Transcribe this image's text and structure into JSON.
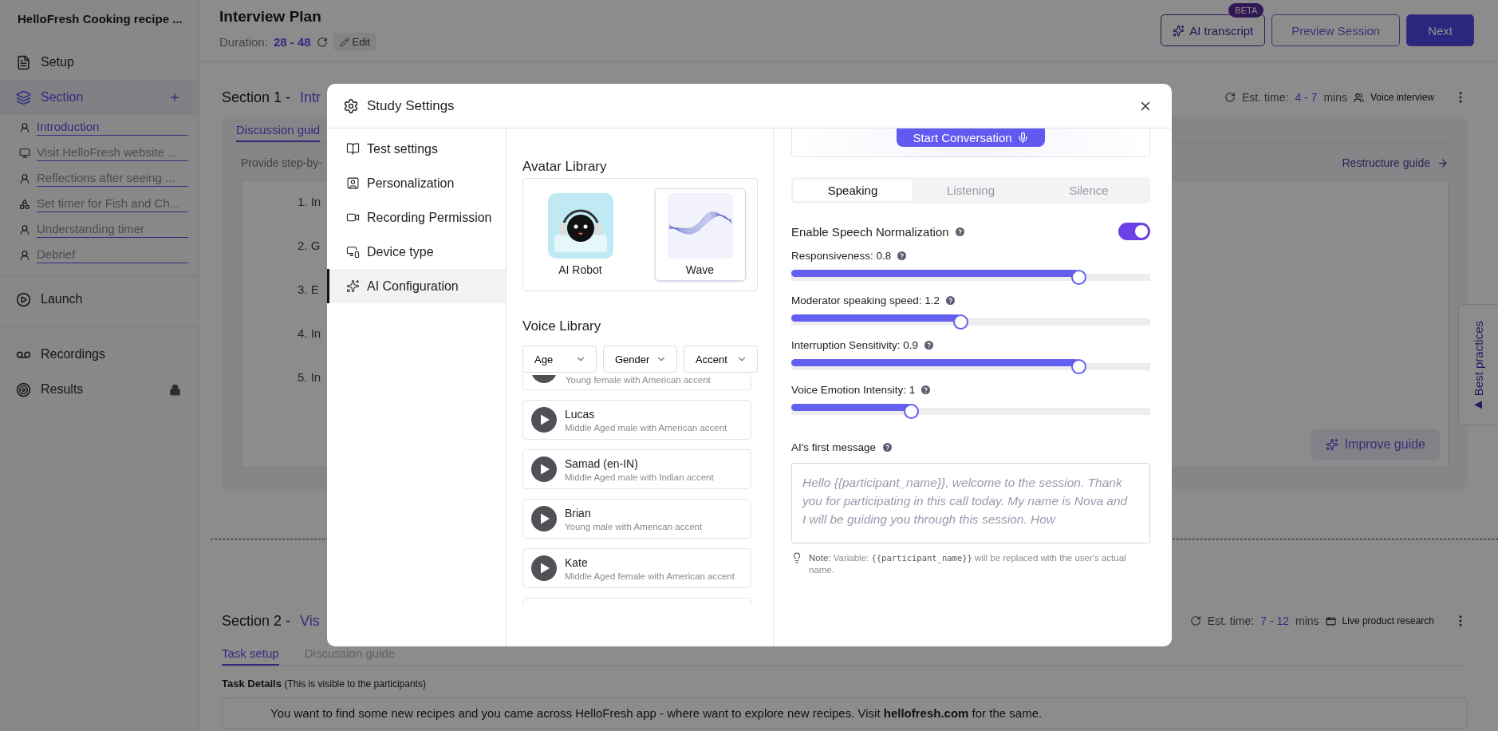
{
  "sidebar": {
    "title": "HelloFresh Cooking recipe ...",
    "nav": [
      {
        "label": "Setup",
        "selected": false,
        "locked": false
      },
      {
        "label": "Section",
        "selected": true,
        "locked": false,
        "children": [
          {
            "label": "Introduction",
            "kind": "interview",
            "selected": true
          },
          {
            "label": "Visit HelloFresh website ...",
            "kind": "website",
            "selected": false
          },
          {
            "label": "Reflections after seeing ...",
            "kind": "interview",
            "selected": false
          },
          {
            "label": "Set timer for Fish and Ch...",
            "kind": "prototype",
            "selected": false
          },
          {
            "label": "Understanding timer",
            "kind": "interview",
            "selected": false
          },
          {
            "label": "Debrief",
            "kind": "interview",
            "selected": false
          }
        ]
      },
      {
        "label": "Launch",
        "selected": false,
        "locked": false
      },
      {
        "label": "Recordings",
        "selected": false,
        "locked": false
      },
      {
        "label": "Results",
        "selected": false,
        "locked": true
      }
    ]
  },
  "header": {
    "title": "Interview Plan",
    "duration_label": "Duration:",
    "duration": "28 - 48",
    "edit": "Edit",
    "buttons": [
      {
        "label": "AI transcript",
        "kind": "ai",
        "badge": "BETA"
      },
      {
        "label": "Preview Session",
        "kind": "outline"
      },
      {
        "label": "Next",
        "kind": "primary"
      }
    ]
  },
  "sections": [
    {
      "kind": "guide",
      "title": "Section 1 -",
      "name": "Intr",
      "est_label": "Est. time:",
      "est": "4 - 7",
      "est_unit": "mins",
      "type": "Voice interview",
      "tabs": [
        {
          "label": "Discussion guid",
          "selected": true
        }
      ],
      "hint": "Provide step-by-",
      "action": "Restructure guide",
      "guide": [
        {
          "number": "1.",
          "text": "In"
        },
        {
          "number": "2.",
          "text": "G"
        },
        {
          "number": "3.",
          "text": "E"
        },
        {
          "number": "4.",
          "text": "In"
        },
        {
          "number": "5.",
          "text": "In"
        }
      ],
      "improve": "Improve guide"
    },
    {
      "kind": "task",
      "title": "Section 2 -",
      "name": "Vis",
      "est_label": "Est. time:",
      "est": "7 - 12",
      "est_unit": "mins",
      "type": "Live product research",
      "tabs": [
        {
          "label": "Task setup",
          "selected": true
        },
        {
          "label": "Discussion guide",
          "selected": false
        }
      ],
      "details_title": "Task Details",
      "details_note": "(This is visible to the participants)",
      "details_text": "You want to find some new recipes and you came across HelloFresh app - where want to explore new recipes. Visit **hellofresh.com** for the same."
    }
  ],
  "best_practices": "Best practices",
  "modal": {
    "title": "Study Settings",
    "nav": [
      {
        "label": "Test settings",
        "selected": false
      },
      {
        "label": "Personalization",
        "selected": false
      },
      {
        "label": "Recording Permission",
        "selected": false
      },
      {
        "label": "Device type",
        "selected": false
      },
      {
        "label": "AI Configuration",
        "selected": true
      }
    ],
    "avatar_library": {
      "title": "Avatar Library",
      "avatars": [
        {
          "label": "AI Robot",
          "kind": "robot",
          "selected": false
        },
        {
          "label": "Wave",
          "kind": "wave",
          "selected": true
        }
      ]
    },
    "voice_library": {
      "title": "Voice Library",
      "filters": [
        "Age",
        "Gender",
        "Accent"
      ],
      "voices": [
        {
          "description": "Young female with American accent"
        },
        {
          "name": "Lucas",
          "description": "Middle Aged male with American accent"
        },
        {
          "name": "Samad (en-IN)",
          "description": "Middle Aged male with Indian accent"
        },
        {
          "name": "Brian",
          "description": "Young male with American accent"
        },
        {
          "name": "Kate",
          "description": "Middle Aged female with American accent"
        }
      ]
    },
    "preview_button": "Start Conversation",
    "tabs": [
      {
        "label": "Speaking",
        "selected": true
      },
      {
        "label": "Listening",
        "selected": false
      },
      {
        "label": "Silence",
        "selected": false
      }
    ],
    "normalization": {
      "label": "Enable Speech Normalization",
      "on": true
    },
    "sliders": [
      {
        "label": "Responsiveness: 0.8",
        "level": 0.8
      },
      {
        "label": "Moderator speaking speed: 1.2",
        "level": 0.47
      },
      {
        "label": "Interruption Sensitivity: 0.9",
        "level": 0.8
      },
      {
        "label": "Voice Emotion Intensity: 1",
        "level": 0.334
      }
    ],
    "first_message": {
      "label": "AI's first message",
      "placeholder": "Hello {{participant_name}}, welcome to the session. Thank you for participating in this call today. My name is Nova and I will be guiding you through this session. How"
    },
    "note": {
      "lead": "Note:",
      "before": "Variable:",
      "code": "{{participant_name}}",
      "after": "will be replaced with the user's actual name."
    }
  }
}
